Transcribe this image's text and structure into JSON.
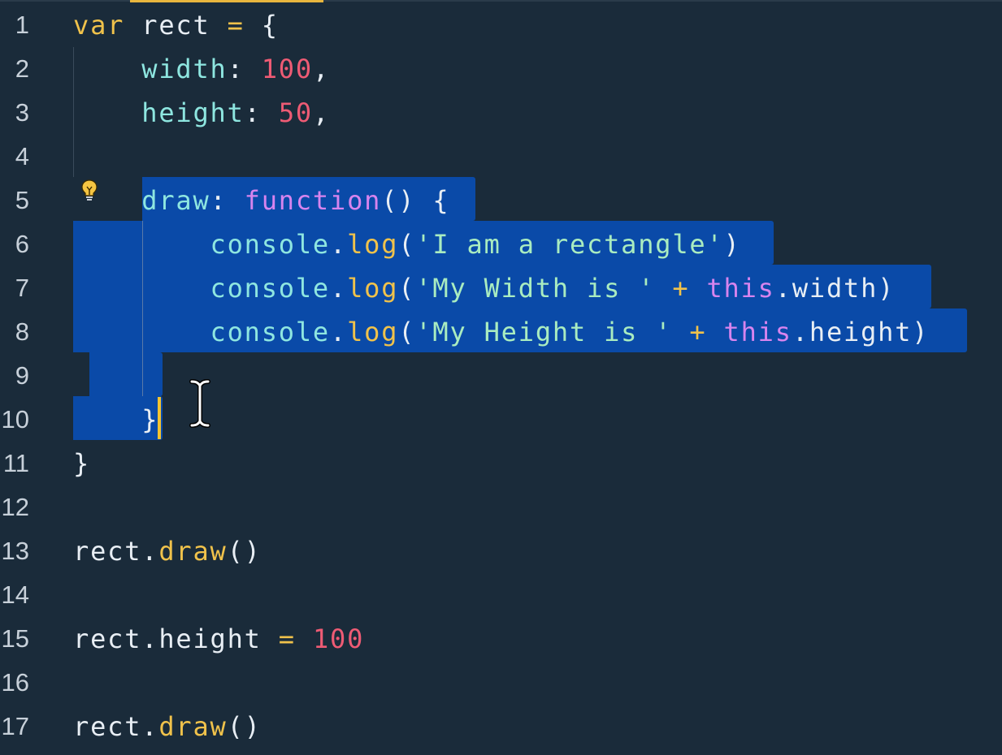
{
  "editor": {
    "lines": [
      {
        "n": "1"
      },
      {
        "n": "2"
      },
      {
        "n": "3"
      },
      {
        "n": "4"
      },
      {
        "n": "5"
      },
      {
        "n": "6"
      },
      {
        "n": "7"
      },
      {
        "n": "8"
      },
      {
        "n": "9"
      },
      {
        "n": "10"
      },
      {
        "n": "11"
      },
      {
        "n": "12"
      },
      {
        "n": "13"
      },
      {
        "n": "14"
      },
      {
        "n": "15"
      },
      {
        "n": "16"
      },
      {
        "n": "17"
      }
    ],
    "tokens": {
      "l1": {
        "var": "var",
        "name": " rect ",
        "eq": "=",
        "brace": " {"
      },
      "l2": {
        "indent": "    ",
        "prop": "width",
        "colon": ": ",
        "num": "100",
        "comma": ","
      },
      "l3": {
        "indent": "    ",
        "prop": "height",
        "colon": ": ",
        "num": "50",
        "comma": ","
      },
      "l5": {
        "indent": "    ",
        "prop": "draw",
        "colon": ": ",
        "fn": "function",
        "rest": "() {"
      },
      "l6": {
        "indent": "        ",
        "obj": "console",
        "dot": ".",
        "method": "log",
        "open": "(",
        "str": "'I am a rectangle'",
        "close": ")"
      },
      "l7": {
        "indent": "        ",
        "obj": "console",
        "dot": ".",
        "method": "log",
        "open": "(",
        "str": "'My Width is '",
        "plus": " + ",
        "this": "this",
        "tail": ".width)"
      },
      "l8": {
        "indent": "        ",
        "obj": "console",
        "dot": ".",
        "method": "log",
        "open": "(",
        "str": "'My Height is '",
        "plus": " + ",
        "this": "this",
        "tail": ".height)"
      },
      "l10": {
        "indent": "    ",
        "brace": "}"
      },
      "l11": {
        "brace": "}"
      },
      "l13": {
        "obj": "rect",
        "dot": ".",
        "method": "draw",
        "call": "()"
      },
      "l15": {
        "obj": "rect.height ",
        "eq": "=",
        "sp": " ",
        "num": "100"
      },
      "l17": {
        "obj": "rect",
        "dot": ".",
        "method": "draw",
        "call": "()"
      }
    },
    "colors": {
      "background": "#1a2b3a",
      "selection": "#0a4aa8",
      "keyword": "#f0c24b",
      "property": "#8ee6e0",
      "number": "#ee5b74",
      "function_keyword": "#d784ee",
      "string": "#a9ecc0",
      "caret": "#f4c430"
    }
  }
}
